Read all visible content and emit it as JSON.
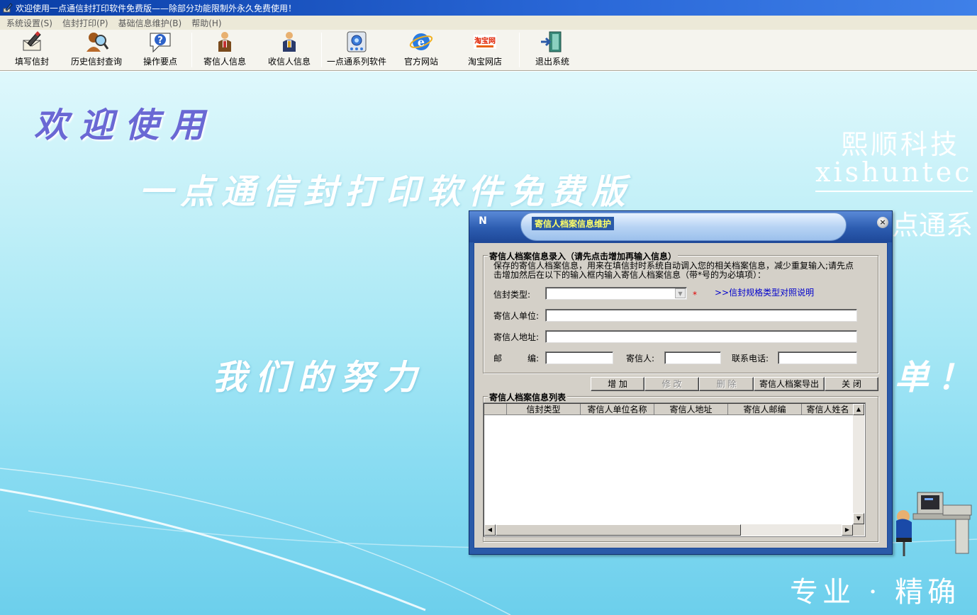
{
  "window": {
    "title": "欢迎使用一点通信封打印软件免费版——除部分功能限制外永久免费使用！"
  },
  "menu": [
    "系统设置(S)",
    "信封打印(P)",
    "基础信息维护(B)",
    "帮助(H)"
  ],
  "toolbar": {
    "fill_envelope": "填写信封",
    "history_query": "历史信封查询",
    "operation_tips": "操作要点",
    "sender_info": "寄信人信息",
    "recipient_info": "收信人信息",
    "series_software": "一点通系列软件",
    "official_site": "官方网站",
    "taobao_store": "淘宝网店",
    "taobao_logo": "淘宝网",
    "exit": "退出系统"
  },
  "background": {
    "welcome": "欢迎使用",
    "product_name": "一点通信封打印软件免费版",
    "company_cn": "熙顺科技",
    "company_en": "xishuntec",
    "series": "点通系",
    "effort": "我们的努力",
    "effort_tail": "单！",
    "slogan": "专业 · 精确"
  },
  "dialog": {
    "title": "寄信人档案信息维护",
    "entry_group_title": "寄信人档案信息录入（请先点击增加再输入信息）",
    "hint": "保存的寄信人档案信息，用来在填信封时系统自动调入您的相关档案信息，减少重复输入;请先点击增加然后在以下的输入框内输入寄信人档案信息（带*号的为必填项）：",
    "fields": {
      "envelope_type_label": "信封类型:",
      "envelope_type_value": "",
      "required_mark": "*",
      "spec_link": ">>信封规格类型对照说明",
      "sender_unit_label": "寄信人单位:",
      "sender_unit_value": "",
      "sender_address_label": "寄信人地址:",
      "sender_address_value": "",
      "postcode_label_a": "邮",
      "postcode_label_b": "编:",
      "postcode_value": "",
      "sender_label": "寄信人:",
      "sender_value": "",
      "phone_label": "联系电话:",
      "phone_value": ""
    },
    "buttons": {
      "add": "增 加",
      "modify": "修 改",
      "delete": "删 除",
      "export": "寄信人档案导出",
      "close": "关 闭"
    },
    "list_group_title": "寄信人档案信息列表",
    "columns": [
      "",
      "信封类型",
      "寄信人单位名称",
      "寄信人地址",
      "寄信人邮编",
      "寄信人姓名"
    ]
  },
  "colors": {
    "title_bar": "#0a3ea6",
    "dialog_frame": "#2a5aa8",
    "dialog_title_text": "#ffff66",
    "link": "#0000cc",
    "required": "#e00000"
  }
}
